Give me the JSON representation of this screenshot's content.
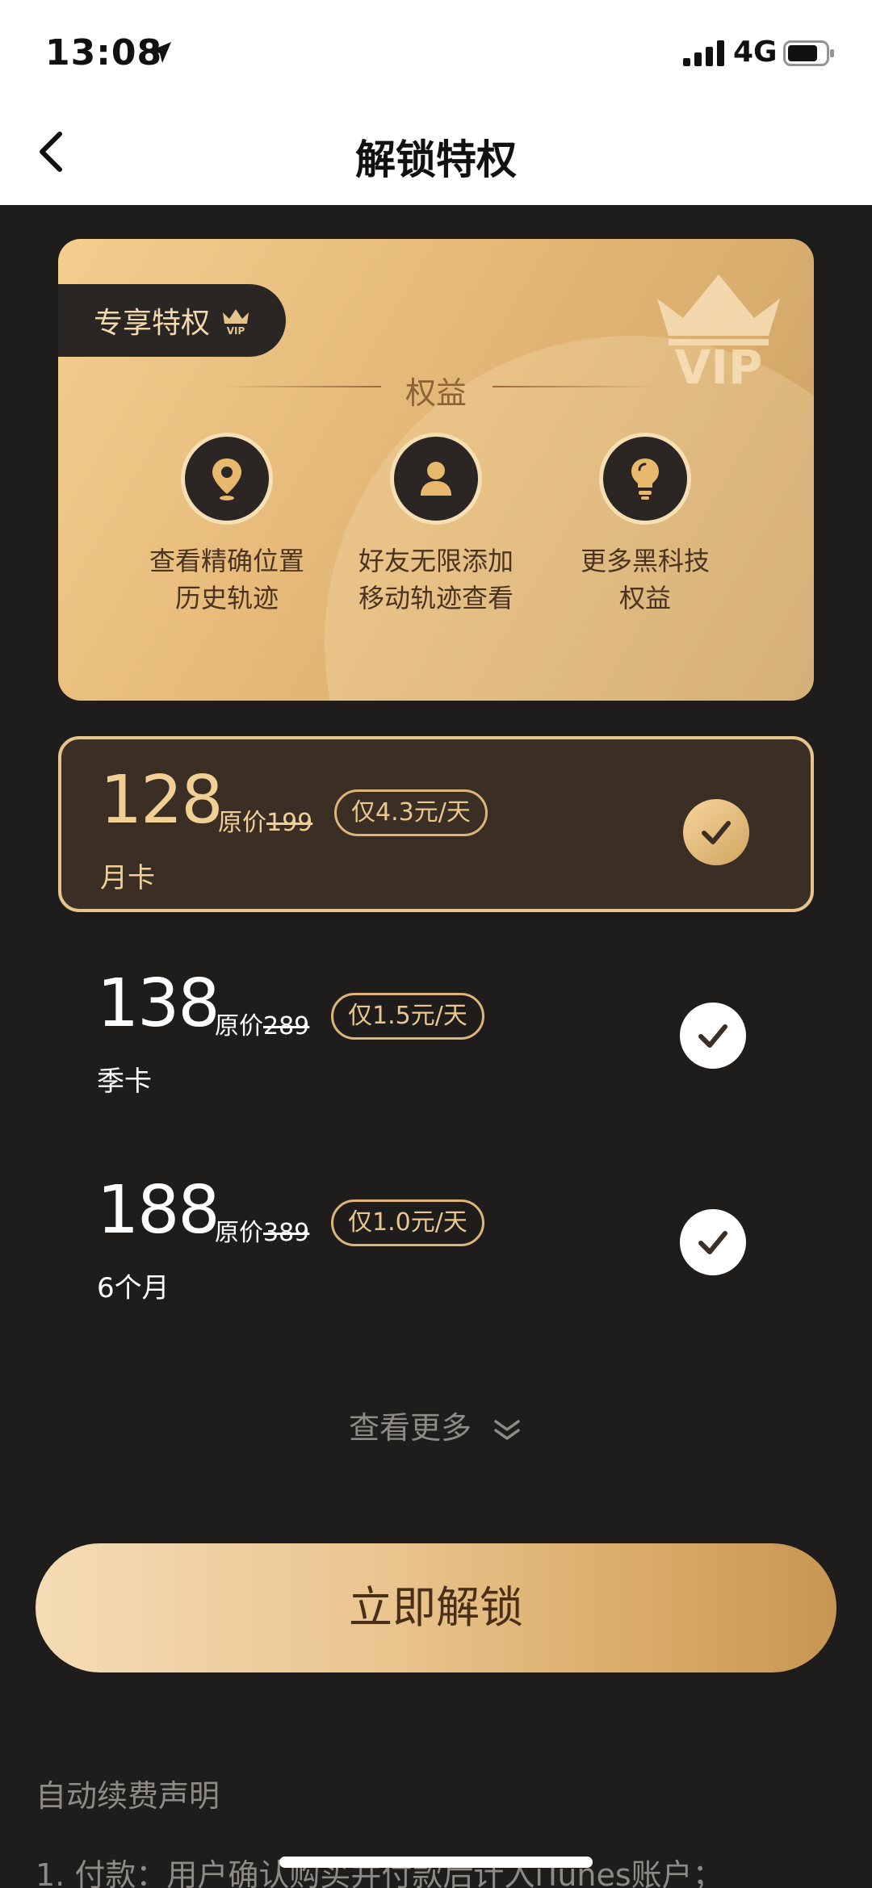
{
  "status_bar": {
    "time": "13:08",
    "network": "4G"
  },
  "nav": {
    "title": "解锁特权",
    "back_icon": "chevron-left-icon"
  },
  "vip_card": {
    "badge_label": "专享特权",
    "badge_icon": "crown-vip-icon",
    "logo_icon": "vip-crown-logo",
    "logo_text": "VIP",
    "rights_title": "权益",
    "perks": [
      {
        "icon": "location-pin-icon",
        "line1": "查看精确位置",
        "line2": "历史轨迹"
      },
      {
        "icon": "person-icon",
        "line1": "好友无限添加",
        "line2": "移动轨迹查看"
      },
      {
        "icon": "lightbulb-icon",
        "line1": "更多黑科技",
        "line2": "权益"
      }
    ]
  },
  "plans": [
    {
      "price": "128",
      "orig_prefix": "原价",
      "orig_price": "199",
      "daily": "仅4.3元/天",
      "name": "月卡",
      "selected": true
    },
    {
      "price": "138",
      "orig_prefix": "原价",
      "orig_price": "289",
      "daily": "仅1.5元/天",
      "name": "季卡",
      "selected": false
    },
    {
      "price": "188",
      "orig_prefix": "原价",
      "orig_price": "389",
      "daily": "仅1.0元/天",
      "name": "6个月",
      "selected": false
    }
  ],
  "see_more_label": "查看更多",
  "unlock_button_label": "立即解锁",
  "notice": {
    "title": "自动续费声明",
    "line1": "1. 付款：用户确认购买并付款后计入iTunes账户；"
  },
  "colors": {
    "gold": "#e8c48d",
    "dark_bg": "#1f1d1c",
    "selected_bg": "#3b2f25"
  }
}
